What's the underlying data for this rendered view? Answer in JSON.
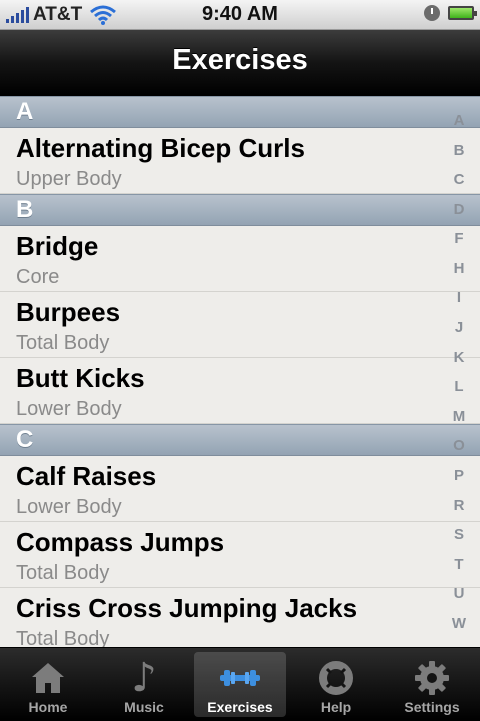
{
  "status_bar": {
    "carrier": "AT&T",
    "time": "9:40 AM"
  },
  "nav": {
    "title": "Exercises"
  },
  "sections": [
    {
      "letter": "A",
      "rows": [
        {
          "name": "Alternating Bicep Curls",
          "category": "Upper Body"
        }
      ]
    },
    {
      "letter": "B",
      "rows": [
        {
          "name": "Bridge",
          "category": "Core"
        },
        {
          "name": "Burpees",
          "category": "Total Body"
        },
        {
          "name": "Butt Kicks",
          "category": "Lower Body"
        }
      ]
    },
    {
      "letter": "C",
      "rows": [
        {
          "name": "Calf Raises",
          "category": "Lower Body"
        },
        {
          "name": "Compass Jumps",
          "category": "Total Body"
        },
        {
          "name": "Criss Cross Jumping Jacks",
          "category": "Total Body"
        }
      ]
    }
  ],
  "index_letters": [
    "A",
    "B",
    "C",
    "D",
    "F",
    "H",
    "I",
    "J",
    "K",
    "L",
    "M",
    "O",
    "P",
    "R",
    "S",
    "T",
    "U",
    "W"
  ],
  "tabs": [
    {
      "label": "Home",
      "icon": "home-icon"
    },
    {
      "label": "Music",
      "icon": "music-note-icon"
    },
    {
      "label": "Exercises",
      "icon": "dumbbell-icon",
      "active": true
    },
    {
      "label": "Help",
      "icon": "lifebuoy-icon"
    },
    {
      "label": "Settings",
      "icon": "gear-icon"
    }
  ],
  "colors": {
    "section_header": "#a3b0bd",
    "active_tab_icon": "#3d8fe0",
    "battery": "#3fb31b"
  }
}
